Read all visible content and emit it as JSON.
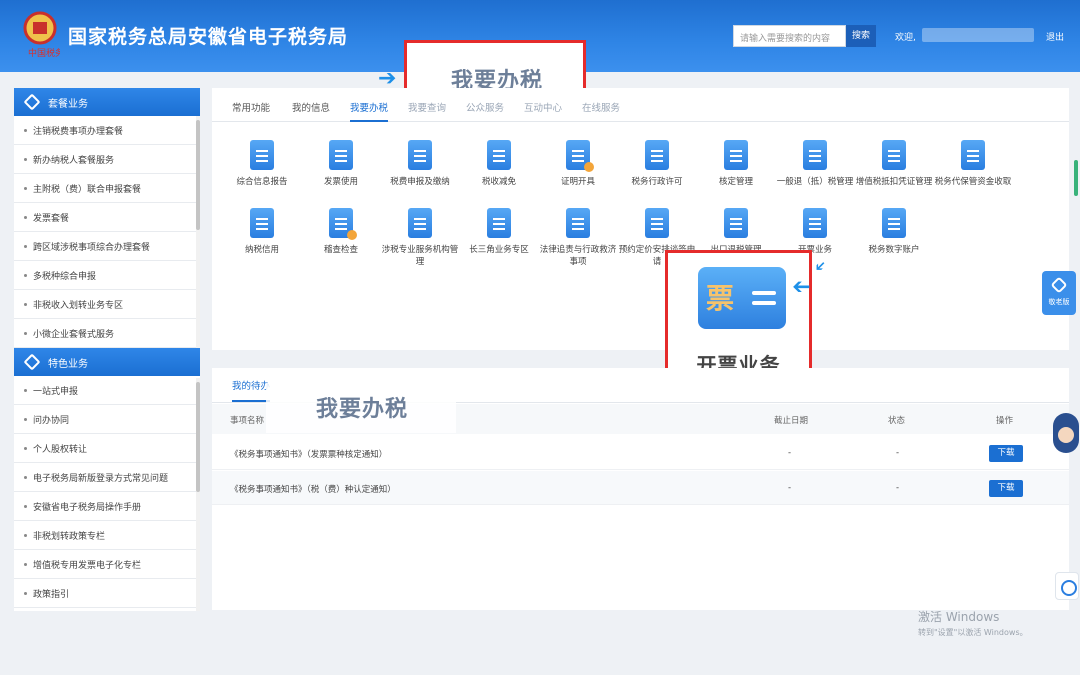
{
  "header": {
    "title": "国家税务总局安徽省电子税务局",
    "search_placeholder": "请输入需要搜索的内容",
    "search_button": "搜索",
    "welcome": "欢迎,",
    "logout": "退出",
    "emblem_icon": "tax-emblem-icon"
  },
  "callout_top": "我要办税",
  "sidebar": {
    "package_title": "套餐业务",
    "package_items": [
      "注销税费事项办理套餐",
      "新办纳税人套餐服务",
      "主附税（费）联合申报套餐",
      "发票套餐",
      "跨区域涉税事项综合办理套餐",
      "多税种综合申报",
      "非税收入划转业务专区",
      "小微企业套餐式服务"
    ],
    "feature_title": "特色业务",
    "feature_items": [
      "一站式申报",
      "问办协同",
      "个人股权转让",
      "电子税务局新版登录方式常见问题",
      "安徽省电子税务局操作手册",
      "非税划转政策专栏",
      "增值税专用发票电子化专栏",
      "政策指引"
    ]
  },
  "tabs": [
    "常用功能",
    "我的信息",
    "我要办税",
    "我要查询",
    "公众服务",
    "互动中心",
    "在线服务"
  ],
  "functions_row1": [
    "综合信息报告",
    "发票使用",
    "税费申报及缴纳",
    "税收减免",
    "证明开具",
    "税务行政许可",
    "核定管理",
    "一般退（抵）税管理",
    "增值税抵扣凭证管理",
    "税务代保管资金收取"
  ],
  "functions_row2": [
    "纳税信用",
    "稽查检查",
    "涉税专业服务机构管理",
    "长三角业务专区",
    "法律追责与行政救济事项",
    "预约定价安排谈签申请",
    "出口退税管理",
    "开票业务",
    "税务数字账户"
  ],
  "callout_ticket": {
    "title": "开票业务",
    "icon_glyph": "票"
  },
  "todo": {
    "tab": "我的待办",
    "overlay": "我要办税",
    "headers": {
      "name": "事项名称",
      "deadline": "截止日期",
      "status": "状态",
      "action": "操作"
    },
    "rows": [
      {
        "name": "《税务事项通知书》（发票票种核定通知）",
        "deadline": "-",
        "status": "-",
        "action": "下载"
      },
      {
        "name": "《税务事项通知书》（税（费）种认定通知）",
        "deadline": "-",
        "status": "-",
        "action": "下载"
      }
    ]
  },
  "float": {
    "old_version": "敬老版"
  },
  "activation": {
    "line1": "激活 Windows",
    "line2": "转到\"设置\"以激活 Windows。"
  },
  "colors": {
    "header_blue": "#2f85e6",
    "accent": "#1b6fd2",
    "highlight_red": "#e52b2b"
  }
}
